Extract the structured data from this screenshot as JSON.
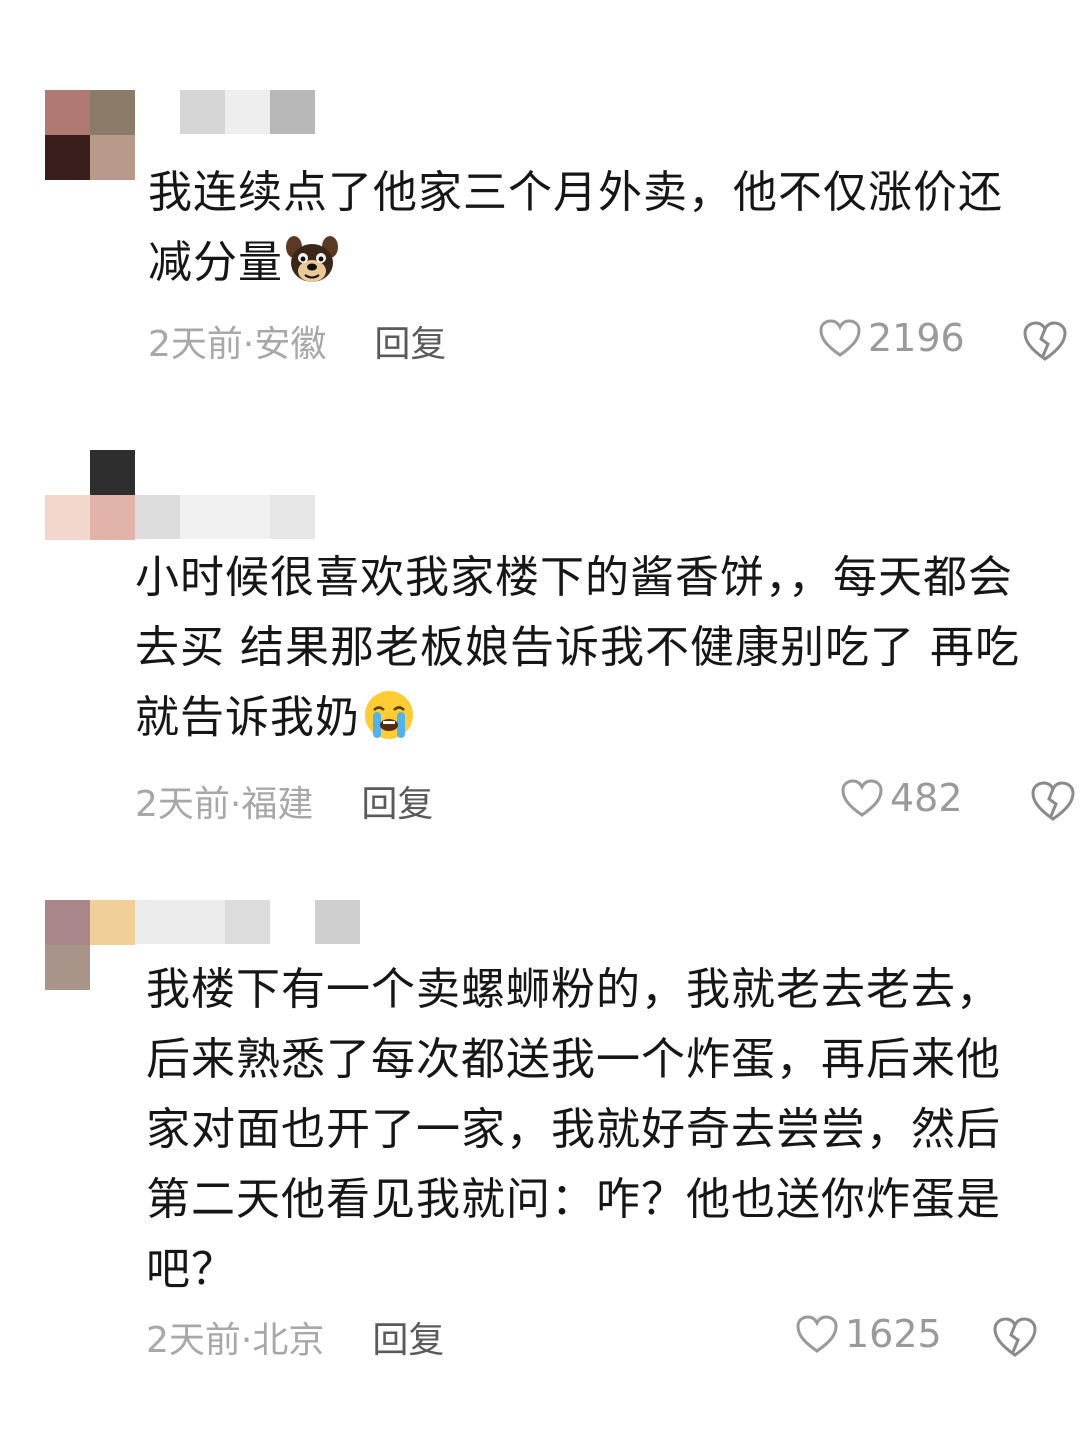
{
  "comments": [
    {
      "text": "我连续点了他家三个月外卖，他不仅涨价还减分量",
      "location": "2天前·安徽",
      "reply_label": "回复",
      "likes": "2196",
      "emoji": "dog-face-emoji"
    },
    {
      "text": "小时候很喜欢我家楼下的酱香饼，，每天都会去买 结果那老板娘告诉我不健康别吃了 再吃就告诉我奶",
      "location": "2天前·福建",
      "reply_label": "回复",
      "likes": "482",
      "emoji": "loudly-crying-face-emoji"
    },
    {
      "text": "我楼下有一个卖螺蛳粉的，我就老去老去，后来熟悉了每次都送我一个炸蛋，再后来他家对面也开了一家，我就好奇去尝尝，然后第二天他看见我就问：咋？他也送你炸蛋是吧？",
      "location": "2天前·北京",
      "reply_label": "回复",
      "likes": "1625"
    }
  ],
  "colors": {
    "text": "#161616",
    "meta": "#a8a8a8",
    "reply": "#5a5a5a",
    "icon": "#9a9a9a"
  },
  "icons": [
    "heart-outline-icon",
    "broken-heart-icon"
  ]
}
